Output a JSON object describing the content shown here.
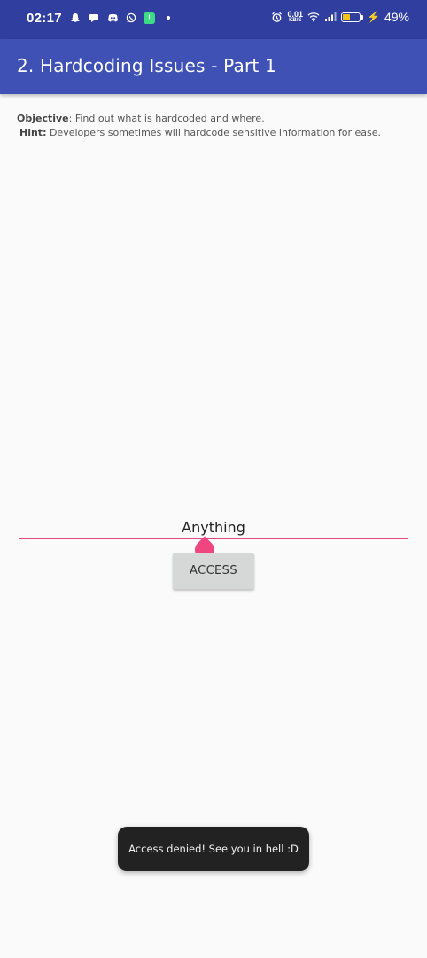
{
  "status_bar": {
    "time": "02:17",
    "left_icons": [
      "snapchat-icon",
      "chat-bubble-icon",
      "discord-icon",
      "whatsapp-icon",
      "app-notification-icon",
      "more-dot-icon"
    ],
    "right_icons": [
      "alarm-icon",
      "wifi-icon",
      "signal-icon",
      "battery-icon",
      "charging-bolt-icon"
    ],
    "net_speed_value": "0.01",
    "net_speed_unit": "KB/S",
    "battery_percent": "49%",
    "battery_level": 0.49,
    "battery_color": "#f5c518"
  },
  "app_bar": {
    "title": "2. Hardcoding Issues - Part 1",
    "color": "#3f51b5",
    "status_color": "#303f9f"
  },
  "info": {
    "objective_label": "Objective",
    "objective_text": ": Find out what is hardcoded and where.",
    "hint_label": "Hint:",
    "hint_text": " Developers sometimes will hardcode sensitive information for ease."
  },
  "form": {
    "input_value": "Anything",
    "accent_color": "#e8457a",
    "access_button_label": "ACCESS"
  },
  "toast": {
    "message": "Access denied! See you in hell :D"
  }
}
